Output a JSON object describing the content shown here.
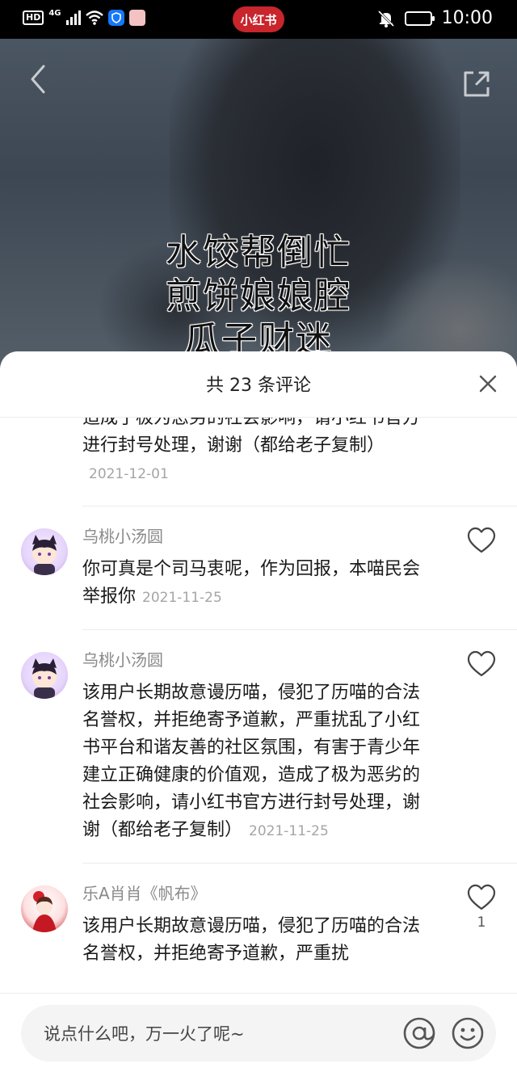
{
  "status_bar": {
    "hd": "HD",
    "network": "4G",
    "app_pill": "小红书",
    "time": "10:00"
  },
  "video": {
    "caption_lines": [
      "水饺帮倒忙",
      "煎饼娘娘腔",
      "瓜子财迷"
    ]
  },
  "comments_sheet": {
    "title": "共 23 条评论",
    "comments": [
      {
        "username": "",
        "text": "造成了极为恶劣的社会影响，请小红书官方进行封号处理，谢谢（都给老子复制）",
        "time": "2021-12-01",
        "likes": ""
      },
      {
        "username": "乌桃小汤圆",
        "text": "你可真是个司马衷呢，作为回报，本喵民会举报你",
        "time": "2021-11-25",
        "likes": ""
      },
      {
        "username": "乌桃小汤圆",
        "text": "该用户长期故意谩历喵，侵犯了历喵的合法名誉权，并拒绝寄予道歉，严重扰乱了小红书平台和谐友善的社区氛围，有害于青少年建立正确健康的价值观，造成了极为恶劣的社会影响，请小红书官方进行封号处理，谢谢（都给老子复制）",
        "time": "2021-11-25",
        "likes": ""
      },
      {
        "username": "乐A肖肖《帆布》",
        "text": "该用户长期故意谩历喵，侵犯了历喵的合法名誉权，并拒绝寄予道歉，严重扰",
        "time": "",
        "likes": "1"
      }
    ]
  },
  "input_bar": {
    "placeholder": "说点什么吧，万一火了呢~"
  },
  "colors": {
    "brand_red": "#c8252c",
    "meta_gray": "#8a8a8a"
  }
}
